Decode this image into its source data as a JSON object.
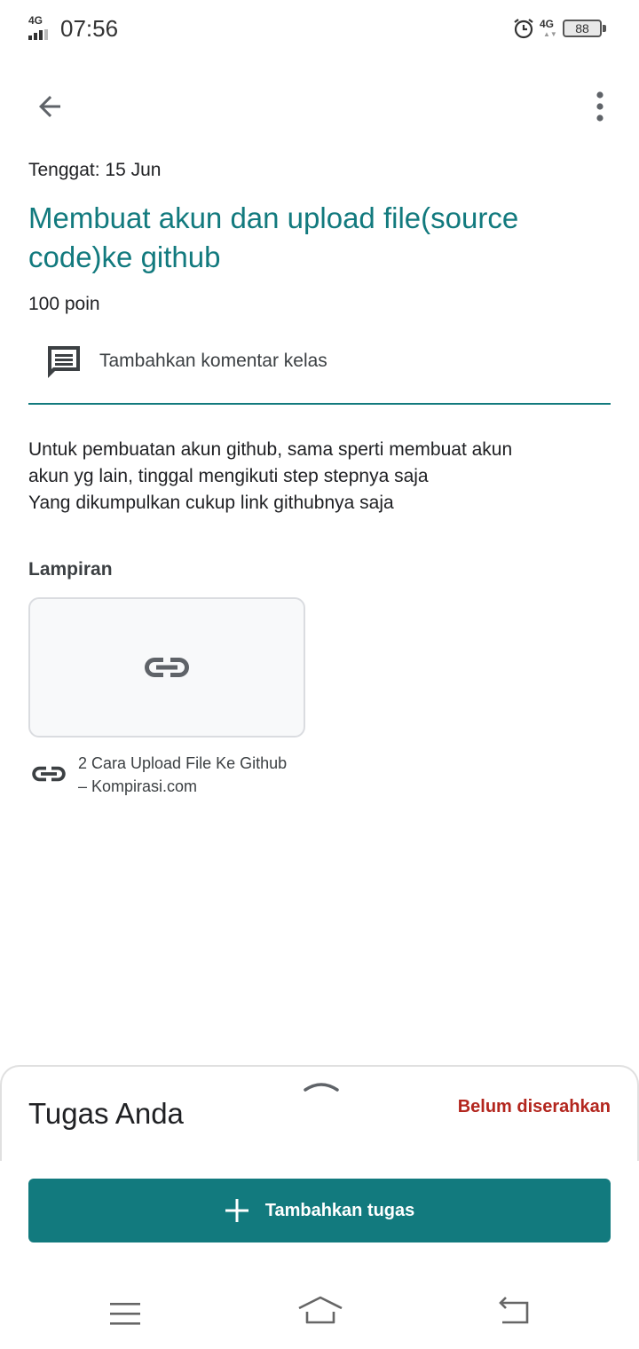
{
  "status_bar": {
    "network_label": "4G",
    "time": "07:56",
    "network_label_right": "4G",
    "battery": "88"
  },
  "header": {
    "back_icon": "arrow-left-icon",
    "more_icon": "more-vert-icon"
  },
  "assignment": {
    "due": "Tenggat: 15 Jun",
    "title": "Membuat akun dan upload file(source code)ke github",
    "points": "100 poin",
    "comment_placeholder": "Tambahkan komentar kelas",
    "description_lines": [
      "Untuk pembuatan akun github, sama sperti membuat akun",
      "akun yg lain, tinggal mengikuti step stepnya saja",
      "Yang dikumpulkan cukup link githubnya saja"
    ]
  },
  "attachments": {
    "heading": "Lampiran",
    "items": [
      {
        "icon": "link-icon",
        "title": "2 Cara Upload File Ke Github – Kompirasi.com"
      }
    ]
  },
  "your_work": {
    "title": "Tugas Anda",
    "status": "Belum diserahkan",
    "add_button_label": "Tambahkan tugas"
  },
  "colors": {
    "accent": "#127a7e",
    "status_missing": "#b3261e",
    "text": "#202124"
  }
}
